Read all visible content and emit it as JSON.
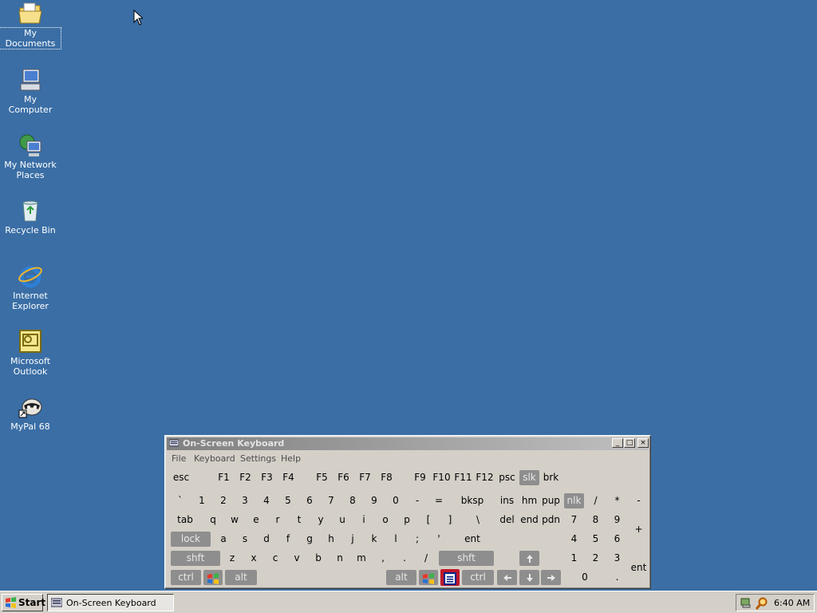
{
  "desktop": {
    "icons": [
      {
        "label": "My Documents",
        "icon": "folder-documents-icon"
      },
      {
        "label": "My Computer",
        "icon": "computer-icon"
      },
      {
        "label": "My Network Places",
        "icon": "network-icon"
      },
      {
        "label": "Recycle Bin",
        "icon": "recycle-bin-icon"
      },
      {
        "label": "Internet Explorer",
        "icon": "ie-icon"
      },
      {
        "label": "Microsoft Outlook",
        "icon": "outlook-icon"
      },
      {
        "label": "MyPal 68",
        "icon": "mypal-icon"
      }
    ]
  },
  "osk": {
    "title": "On-Screen Keyboard",
    "minimize": "_",
    "maximize": "□",
    "close": "×",
    "menu": [
      "File",
      "Keyboard",
      "Settings",
      "Help"
    ],
    "keys": {
      "row0": [
        "esc",
        "F1",
        "F2",
        "F3",
        "F4",
        "F5",
        "F6",
        "F7",
        "F8",
        "F9",
        "F10",
        "F11",
        "F12",
        "psc",
        "slk",
        "brk"
      ],
      "row1": [
        "`",
        "1",
        "2",
        "3",
        "4",
        "5",
        "6",
        "7",
        "8",
        "9",
        "0",
        "-",
        "=",
        "bksp",
        "ins",
        "hm",
        "pup",
        "nlk",
        "/",
        "*",
        "-"
      ],
      "row2": [
        "tab",
        "q",
        "w",
        "e",
        "r",
        "t",
        "y",
        "u",
        "i",
        "o",
        "p",
        "[",
        "]",
        "\\",
        "del",
        "end",
        "pdn",
        "7",
        "8",
        "9",
        "+"
      ],
      "row3": [
        "lock",
        "a",
        "s",
        "d",
        "f",
        "g",
        "h",
        "j",
        "k",
        "l",
        ";",
        "'",
        "ent",
        "4",
        "5",
        "6"
      ],
      "row4": [
        "shft",
        "z",
        "x",
        "c",
        "v",
        "b",
        "n",
        "m",
        ",",
        ".",
        "/",
        "shft",
        "1",
        "2",
        "3",
        "ent"
      ],
      "row5": [
        "ctrl",
        "alt",
        "alt",
        "ctrl",
        "0",
        "."
      ]
    }
  },
  "taskbar": {
    "start": "Start",
    "task": "On-Screen Keyboard",
    "clock": "6:40 AM"
  }
}
